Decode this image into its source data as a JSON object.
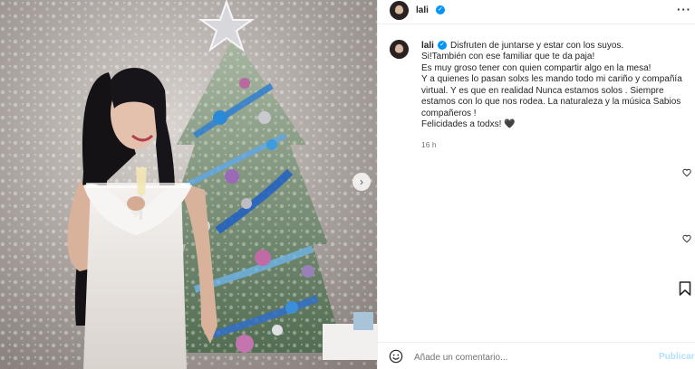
{
  "post": {
    "username": "lali",
    "verified_glyph": "✓",
    "more_glyph": "···",
    "caption": {
      "first_line": "Disfruten de juntarse y estar con los suyos.",
      "lines": [
        "Si!También con ese familiar que te da paja!",
        "Es muy groso tener con quien compartir algo en la mesa!",
        "Y a quienes lo pasan solxs les mando todo mi cariño y compañía",
        "virtual. Y es que en realidad Nunca estamos solos . Siempre",
        "estamos con lo que nos rodea. La naturaleza y la música Sabios",
        "compañeros !",
        "Felicidades a todxs! 🖤"
      ]
    },
    "time_ago": "16 h",
    "next_glyph": "›"
  },
  "comment": {
    "placeholder": "Añade un comentario...",
    "publish_label": "Publicar"
  },
  "icons": {
    "avatar": "profile-avatar",
    "verified": "verified-badge-icon",
    "more": "more-options-icon",
    "heart": "heart-icon",
    "bookmark": "bookmark-icon",
    "emoji": "emoji-icon",
    "next": "chevron-right-icon"
  },
  "colors": {
    "verified": "#0095f6",
    "publish_disabled": "#b2dffc",
    "text": "#262626",
    "secondary": "#737373"
  }
}
